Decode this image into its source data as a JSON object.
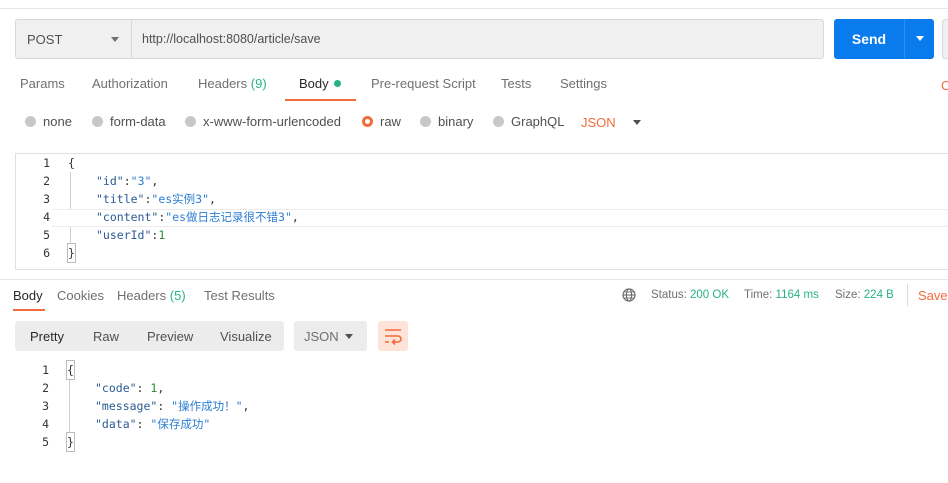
{
  "request": {
    "method": "POST",
    "url": "http://localhost:8080/article/save",
    "send_label": "Send"
  },
  "request_tabs": {
    "params": "Params",
    "authorization": "Authorization",
    "headers": "Headers",
    "headers_count": "(9)",
    "body": "Body",
    "prerequest": "Pre-request Script",
    "tests": "Tests",
    "settings": "Settings",
    "right_cut": "C"
  },
  "body_types": {
    "none": "none",
    "form_data": "form-data",
    "urlencoded": "x-www-form-urlencoded",
    "raw": "raw",
    "binary": "binary",
    "graphql": "GraphQL",
    "format": "JSON"
  },
  "request_body": {
    "line_numbers": [
      "1",
      "2",
      "3",
      "4",
      "5",
      "6"
    ],
    "open": "{",
    "id_key": "\"id\"",
    "id_val": "\"3\"",
    "title_key": "\"title\"",
    "title_val": "\"es实例3\"",
    "content_key": "\"content\"",
    "content_val": "\"es做日志记录很不错3\"",
    "userid_key": "\"userId\"",
    "userid_val": "1",
    "close": "}"
  },
  "response_tabs": {
    "body": "Body",
    "cookies": "Cookies",
    "headers": "Headers",
    "headers_count": "(5)",
    "test_results": "Test Results"
  },
  "response_status": {
    "status_label": "Status:",
    "status_value": "200 OK",
    "time_label": "Time:",
    "time_value": "1164 ms",
    "size_label": "Size:",
    "size_value": "224 B",
    "save_label": "Save"
  },
  "view_tabs": {
    "pretty": "Pretty",
    "raw": "Raw",
    "preview": "Preview",
    "visualize": "Visualize",
    "format": "JSON"
  },
  "response_body": {
    "line_numbers": [
      "1",
      "2",
      "3",
      "4",
      "5"
    ],
    "open": "{",
    "code_key": "\"code\"",
    "code_val": "1",
    "message_key": "\"message\"",
    "message_val": "\"操作成功！\"",
    "data_key": "\"data\"",
    "data_val": "\"保存成功\"",
    "close": "}"
  },
  "colors": {
    "accent": "#f26b3a",
    "send": "#097bed",
    "success": "#26b47f"
  }
}
